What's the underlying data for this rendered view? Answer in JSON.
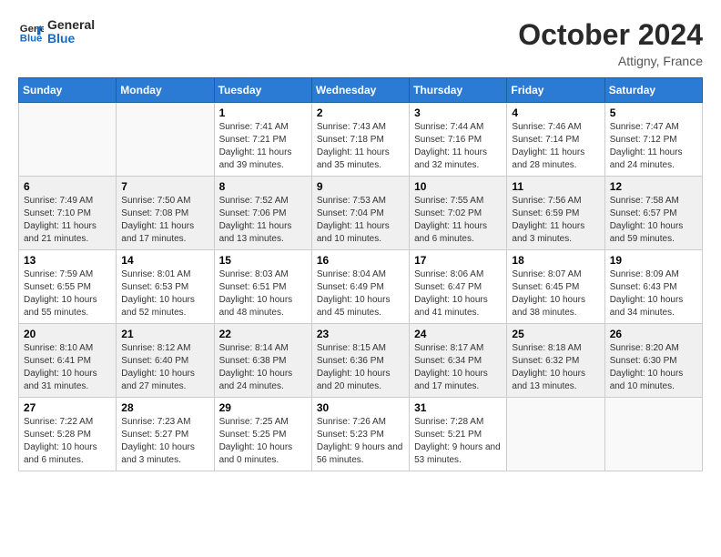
{
  "header": {
    "logo_line1": "General",
    "logo_line2": "Blue",
    "month_title": "October 2024",
    "location": "Attigny, France"
  },
  "weekdays": [
    "Sunday",
    "Monday",
    "Tuesday",
    "Wednesday",
    "Thursday",
    "Friday",
    "Saturday"
  ],
  "weeks": [
    [
      {
        "day": "",
        "sunrise": "",
        "sunset": "",
        "daylight": ""
      },
      {
        "day": "",
        "sunrise": "",
        "sunset": "",
        "daylight": ""
      },
      {
        "day": "1",
        "sunrise": "Sunrise: 7:41 AM",
        "sunset": "Sunset: 7:21 PM",
        "daylight": "Daylight: 11 hours and 39 minutes."
      },
      {
        "day": "2",
        "sunrise": "Sunrise: 7:43 AM",
        "sunset": "Sunset: 7:18 PM",
        "daylight": "Daylight: 11 hours and 35 minutes."
      },
      {
        "day": "3",
        "sunrise": "Sunrise: 7:44 AM",
        "sunset": "Sunset: 7:16 PM",
        "daylight": "Daylight: 11 hours and 32 minutes."
      },
      {
        "day": "4",
        "sunrise": "Sunrise: 7:46 AM",
        "sunset": "Sunset: 7:14 PM",
        "daylight": "Daylight: 11 hours and 28 minutes."
      },
      {
        "day": "5",
        "sunrise": "Sunrise: 7:47 AM",
        "sunset": "Sunset: 7:12 PM",
        "daylight": "Daylight: 11 hours and 24 minutes."
      }
    ],
    [
      {
        "day": "6",
        "sunrise": "Sunrise: 7:49 AM",
        "sunset": "Sunset: 7:10 PM",
        "daylight": "Daylight: 11 hours and 21 minutes."
      },
      {
        "day": "7",
        "sunrise": "Sunrise: 7:50 AM",
        "sunset": "Sunset: 7:08 PM",
        "daylight": "Daylight: 11 hours and 17 minutes."
      },
      {
        "day": "8",
        "sunrise": "Sunrise: 7:52 AM",
        "sunset": "Sunset: 7:06 PM",
        "daylight": "Daylight: 11 hours and 13 minutes."
      },
      {
        "day": "9",
        "sunrise": "Sunrise: 7:53 AM",
        "sunset": "Sunset: 7:04 PM",
        "daylight": "Daylight: 11 hours and 10 minutes."
      },
      {
        "day": "10",
        "sunrise": "Sunrise: 7:55 AM",
        "sunset": "Sunset: 7:02 PM",
        "daylight": "Daylight: 11 hours and 6 minutes."
      },
      {
        "day": "11",
        "sunrise": "Sunrise: 7:56 AM",
        "sunset": "Sunset: 6:59 PM",
        "daylight": "Daylight: 11 hours and 3 minutes."
      },
      {
        "day": "12",
        "sunrise": "Sunrise: 7:58 AM",
        "sunset": "Sunset: 6:57 PM",
        "daylight": "Daylight: 10 hours and 59 minutes."
      }
    ],
    [
      {
        "day": "13",
        "sunrise": "Sunrise: 7:59 AM",
        "sunset": "Sunset: 6:55 PM",
        "daylight": "Daylight: 10 hours and 55 minutes."
      },
      {
        "day": "14",
        "sunrise": "Sunrise: 8:01 AM",
        "sunset": "Sunset: 6:53 PM",
        "daylight": "Daylight: 10 hours and 52 minutes."
      },
      {
        "day": "15",
        "sunrise": "Sunrise: 8:03 AM",
        "sunset": "Sunset: 6:51 PM",
        "daylight": "Daylight: 10 hours and 48 minutes."
      },
      {
        "day": "16",
        "sunrise": "Sunrise: 8:04 AM",
        "sunset": "Sunset: 6:49 PM",
        "daylight": "Daylight: 10 hours and 45 minutes."
      },
      {
        "day": "17",
        "sunrise": "Sunrise: 8:06 AM",
        "sunset": "Sunset: 6:47 PM",
        "daylight": "Daylight: 10 hours and 41 minutes."
      },
      {
        "day": "18",
        "sunrise": "Sunrise: 8:07 AM",
        "sunset": "Sunset: 6:45 PM",
        "daylight": "Daylight: 10 hours and 38 minutes."
      },
      {
        "day": "19",
        "sunrise": "Sunrise: 8:09 AM",
        "sunset": "Sunset: 6:43 PM",
        "daylight": "Daylight: 10 hours and 34 minutes."
      }
    ],
    [
      {
        "day": "20",
        "sunrise": "Sunrise: 8:10 AM",
        "sunset": "Sunset: 6:41 PM",
        "daylight": "Daylight: 10 hours and 31 minutes."
      },
      {
        "day": "21",
        "sunrise": "Sunrise: 8:12 AM",
        "sunset": "Sunset: 6:40 PM",
        "daylight": "Daylight: 10 hours and 27 minutes."
      },
      {
        "day": "22",
        "sunrise": "Sunrise: 8:14 AM",
        "sunset": "Sunset: 6:38 PM",
        "daylight": "Daylight: 10 hours and 24 minutes."
      },
      {
        "day": "23",
        "sunrise": "Sunrise: 8:15 AM",
        "sunset": "Sunset: 6:36 PM",
        "daylight": "Daylight: 10 hours and 20 minutes."
      },
      {
        "day": "24",
        "sunrise": "Sunrise: 8:17 AM",
        "sunset": "Sunset: 6:34 PM",
        "daylight": "Daylight: 10 hours and 17 minutes."
      },
      {
        "day": "25",
        "sunrise": "Sunrise: 8:18 AM",
        "sunset": "Sunset: 6:32 PM",
        "daylight": "Daylight: 10 hours and 13 minutes."
      },
      {
        "day": "26",
        "sunrise": "Sunrise: 8:20 AM",
        "sunset": "Sunset: 6:30 PM",
        "daylight": "Daylight: 10 hours and 10 minutes."
      }
    ],
    [
      {
        "day": "27",
        "sunrise": "Sunrise: 7:22 AM",
        "sunset": "Sunset: 5:28 PM",
        "daylight": "Daylight: 10 hours and 6 minutes."
      },
      {
        "day": "28",
        "sunrise": "Sunrise: 7:23 AM",
        "sunset": "Sunset: 5:27 PM",
        "daylight": "Daylight: 10 hours and 3 minutes."
      },
      {
        "day": "29",
        "sunrise": "Sunrise: 7:25 AM",
        "sunset": "Sunset: 5:25 PM",
        "daylight": "Daylight: 10 hours and 0 minutes."
      },
      {
        "day": "30",
        "sunrise": "Sunrise: 7:26 AM",
        "sunset": "Sunset: 5:23 PM",
        "daylight": "Daylight: 9 hours and 56 minutes."
      },
      {
        "day": "31",
        "sunrise": "Sunrise: 7:28 AM",
        "sunset": "Sunset: 5:21 PM",
        "daylight": "Daylight: 9 hours and 53 minutes."
      },
      {
        "day": "",
        "sunrise": "",
        "sunset": "",
        "daylight": ""
      },
      {
        "day": "",
        "sunrise": "",
        "sunset": "",
        "daylight": ""
      }
    ]
  ]
}
